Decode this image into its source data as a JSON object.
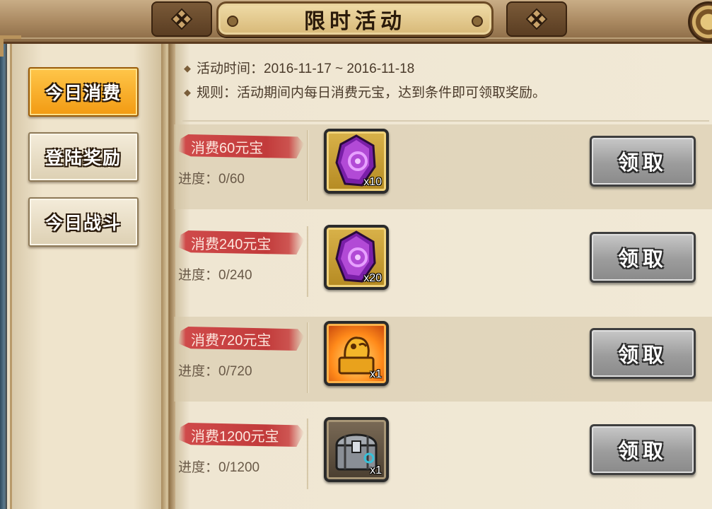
{
  "window": {
    "title": "限时活动"
  },
  "tabs": [
    {
      "label": "今日消费",
      "active": true
    },
    {
      "label": "登陆奖励",
      "active": false
    },
    {
      "label": "今日战斗",
      "active": false
    }
  ],
  "info": {
    "time_label": "活动时间：2016-11-17 ~ 2016-11-18",
    "rule_label": "规则：活动期间内每日消费元宝，达到条件即可领取奖励。"
  },
  "rewards": [
    {
      "cost": "消费60元宝",
      "progress": "进度：0/60",
      "item_icon": "purple-gem-icon",
      "qty": "x10",
      "button": "领取"
    },
    {
      "cost": "消费240元宝",
      "progress": "进度：0/240",
      "item_icon": "purple-gem-icon",
      "qty": "x20",
      "button": "领取"
    },
    {
      "cost": "消费720元宝",
      "progress": "进度：0/720",
      "item_icon": "golden-seal-icon",
      "qty": "x1",
      "button": "领取"
    },
    {
      "cost": "消费1200元宝",
      "progress": "进度：0/1200",
      "item_icon": "treasure-chest-icon",
      "qty": "x1",
      "button": "领取"
    }
  ],
  "colors": {
    "active_tab": "#f29a12",
    "cost_banner": "#c23b3b",
    "claim_button": "#9c9c9c"
  }
}
